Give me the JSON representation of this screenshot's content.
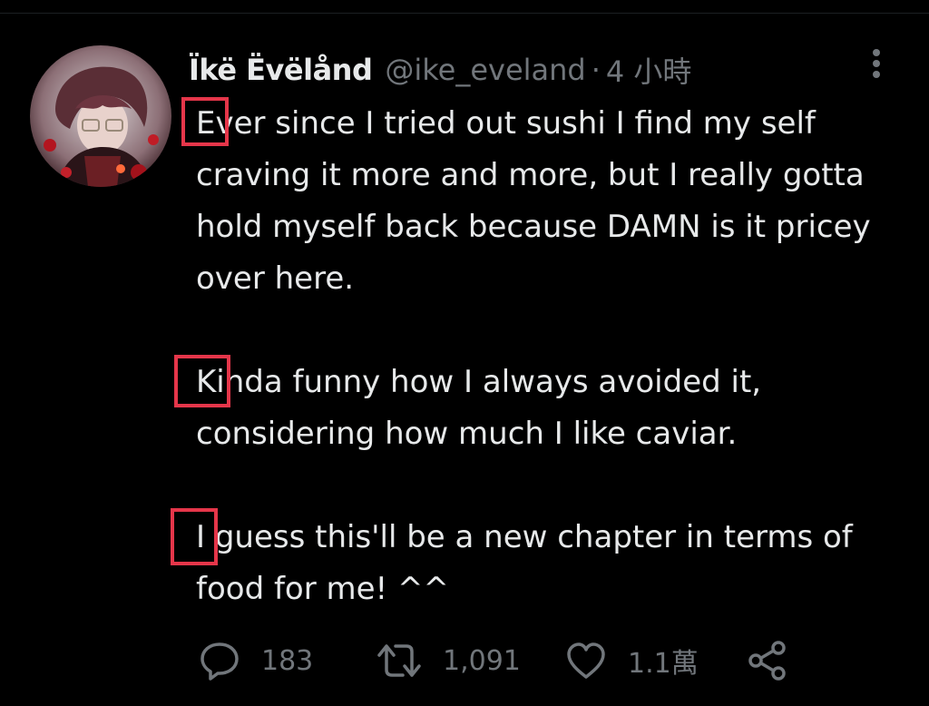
{
  "author": {
    "display_name": "Ïkë Ëvëlånd",
    "handle": "@ike_eveland",
    "separator": "·",
    "time": "4 小時"
  },
  "tweet": {
    "paragraphs": [
      "Ever since I tried out sushi I find my self craving it more and more, but I really gotta hold myself back because DAMN is it pricey over here.",
      "Kinda funny how I always avoided it, considering how much I like caviar.",
      "I guess this'll be a new chapter in terms of food for me! ^^"
    ],
    "highlighted_letters": [
      "E",
      "K",
      "I"
    ]
  },
  "actions": {
    "reply_count": "183",
    "retweet_count": "1,091",
    "like_count": "1.1萬"
  },
  "icons": {
    "reply": "speech-bubble-icon",
    "retweet": "retweet-arrows-icon",
    "like": "heart-icon",
    "share": "share-nodes-icon",
    "more": "vertical-dots-icon"
  },
  "colors": {
    "background": "#000000",
    "text": "#e7e9ea",
    "muted": "#71767b",
    "highlight_box": "#e5364a"
  }
}
